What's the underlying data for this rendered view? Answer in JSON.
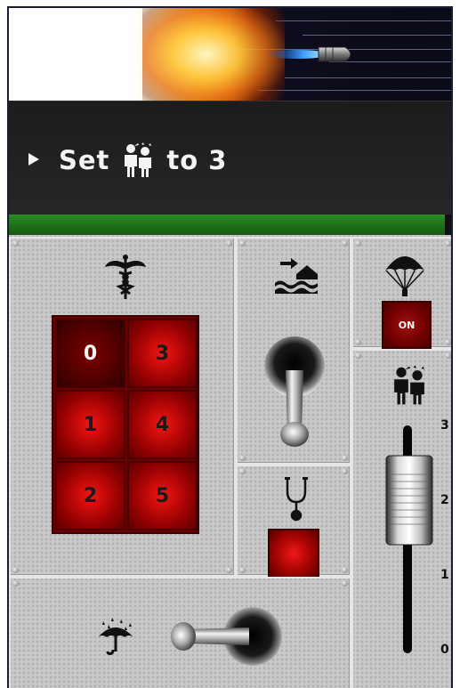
{
  "instruction": {
    "prefix": "Set",
    "icon": "crowd-person-icon",
    "suffix": "to 3"
  },
  "timer": {
    "fraction": 0.986
  },
  "keypad": {
    "icon": "caduceus-icon",
    "keys": [
      "0",
      "3",
      "1",
      "4",
      "2",
      "5"
    ],
    "selected": "0"
  },
  "toggle_flood": {
    "icon": "flood-house-icon",
    "state": "down"
  },
  "parachute": {
    "icon": "parachute-icon",
    "button_label": "ON"
  },
  "stethoscope": {
    "icon": "stethoscope-icon"
  },
  "umbrella": {
    "icon": "umbrella-rain-icon",
    "state": "left"
  },
  "slider": {
    "icon": "crowd-person-icon",
    "scale": [
      "3",
      "2",
      "1",
      "0"
    ],
    "value": 2
  },
  "colors": {
    "timer_green": "#2c8c24",
    "button_red": "#c00808",
    "board_gray": "#c9c9c9"
  }
}
